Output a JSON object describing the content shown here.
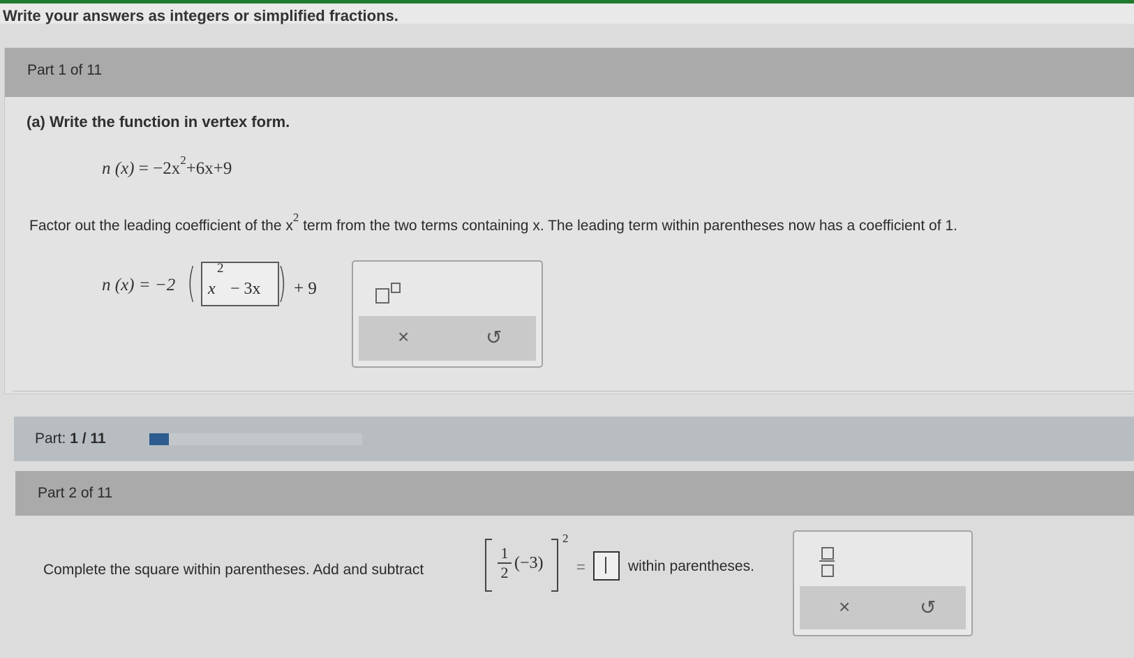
{
  "header": {
    "instruction": "Write your answers as integers or simplified fractions."
  },
  "part1": {
    "title": "Part 1 of 11",
    "question_label": "(a) Write the function in vertex form.",
    "function_lhs": "n (x)",
    "function_rhs_a": "= −2x",
    "function_exp": "2",
    "function_rhs_b": "+6x+9",
    "factor_text_a": "Factor out the leading coefficient of the x",
    "factor_exp": "2",
    "factor_text_b": " term from the two terms containing x. The leading term within parentheses now has a coefficient of 1.",
    "step_lhs": "n (x) = −2",
    "answer_x": "x",
    "answer_exp": "2",
    "answer_rest": "− 3x",
    "step_tail": "+ 9",
    "toolbar": {
      "clear_icon": "×",
      "undo_icon": "↺"
    }
  },
  "progress": {
    "label": "Part:",
    "current": "1 / 11",
    "fraction": 0.0909
  },
  "part2": {
    "title": "Part 2 of 11",
    "complete_text": "Complete the square within parentheses. Add and subtract",
    "frac_num": "1",
    "frac_den": "2",
    "inner_value": "(−3)",
    "exponent": "2",
    "equals": "=",
    "within_text": "within parentheses.",
    "toolbar": {
      "clear_icon": "×",
      "undo_icon": "↺"
    }
  }
}
